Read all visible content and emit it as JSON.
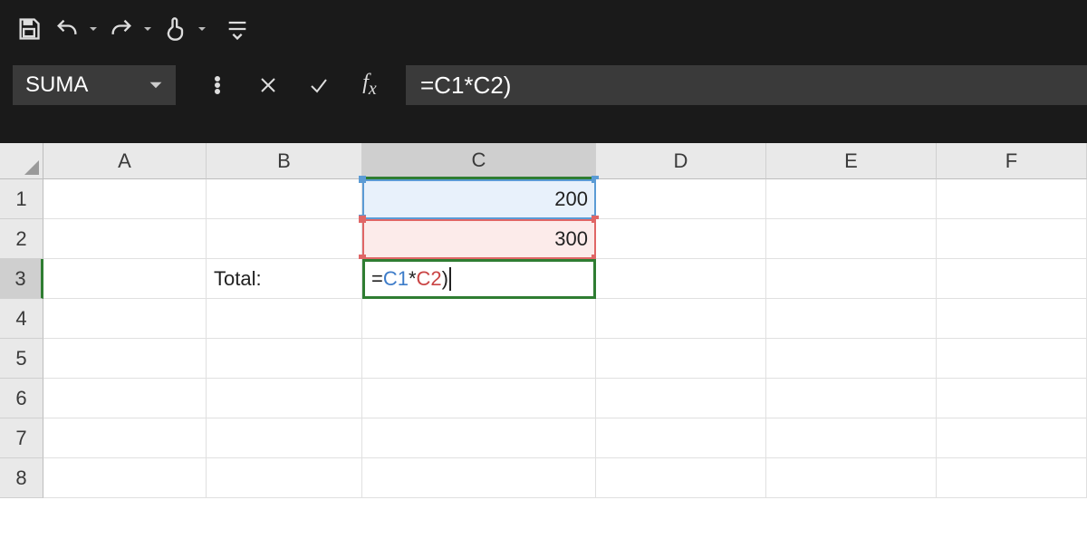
{
  "toolbar": {
    "save_icon": "save-icon",
    "undo_icon": "undo-icon",
    "redo_icon": "redo-icon",
    "touch_icon": "touch-mode-icon",
    "customize_icon": "customize-qat-icon"
  },
  "formula_bar": {
    "name_box_value": "SUMA",
    "formula_text": "=C1*C2)",
    "tokens": {
      "eq": "=",
      "c1": "C1",
      "op": "*",
      "c2": "C2",
      "paren": ")"
    }
  },
  "columns": [
    "A",
    "B",
    "C",
    "D",
    "E",
    "F"
  ],
  "rows": [
    "1",
    "2",
    "3",
    "4",
    "5",
    "6",
    "7",
    "8"
  ],
  "active_column": "C",
  "active_row": "3",
  "cells": {
    "B3": "Total:",
    "C1": "200",
    "C2": "300"
  }
}
